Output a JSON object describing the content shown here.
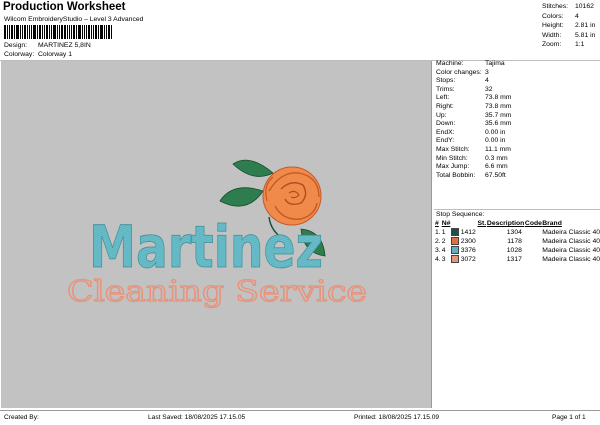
{
  "header": {
    "title": "Production Worksheet",
    "subtitle": "Wilcom EmbroideryStudio – Level 3 Advanced",
    "design_label": "Design:",
    "design_value": "MARTINEZ 5,8IN",
    "colorway_label": "Colorway:",
    "colorway_value": "Colorway 1"
  },
  "stats": [
    {
      "label": "Stitches:",
      "value": "10162"
    },
    {
      "label": "Colors:",
      "value": "4"
    },
    {
      "label": "Height:",
      "value": "2.81 in"
    },
    {
      "label": "Width:",
      "value": "5.81 in"
    },
    {
      "label": "Zoom:",
      "value": "1:1"
    }
  ],
  "design": {
    "word1": "Martinez",
    "word2": "Cleaning Service"
  },
  "machine_info": [
    {
      "label": "Machine:",
      "value": "Tajima"
    },
    {
      "label": "Color changes:",
      "value": "3"
    },
    {
      "label": "Stops:",
      "value": "4"
    },
    {
      "label": "Trims:",
      "value": "32"
    },
    {
      "label": "Left:",
      "value": "73.8 mm"
    },
    {
      "label": "Right:",
      "value": "73.8 mm"
    },
    {
      "label": "Up:",
      "value": "35.7 mm"
    },
    {
      "label": "Down:",
      "value": "35.6 mm"
    },
    {
      "label": "EndX:",
      "value": "0.00 in"
    },
    {
      "label": "EndY:",
      "value": "0.00 in"
    },
    {
      "label": "Max Stitch:",
      "value": "11.1 mm"
    },
    {
      "label": "Min Stitch:",
      "value": "0.3 mm"
    },
    {
      "label": "Max Jump:",
      "value": "6.6 mm"
    },
    {
      "label": "Total Bobbin:",
      "value": "67.50ft"
    }
  ],
  "stop_sequence": {
    "title": "Stop Sequence:",
    "headers": [
      "#",
      "N#",
      "St.",
      "Description",
      "Code",
      "Brand"
    ],
    "rows": [
      {
        "idx": "1.",
        "n": "1",
        "color": "#1e4f49",
        "code_num": "1412",
        "st": "1304",
        "brand": "Madeira Classic 40"
      },
      {
        "idx": "2.",
        "n": "2",
        "color": "#e0713f",
        "code_num": "2300",
        "st": "1178",
        "brand": "Madeira Classic 40"
      },
      {
        "idx": "3.",
        "n": "4",
        "color": "#5eb1bf",
        "code_num": "3376",
        "st": "1028",
        "brand": "Madeira Classic 40"
      },
      {
        "idx": "4.",
        "n": "3",
        "color": "#e8937a",
        "code_num": "3072",
        "st": "1317",
        "brand": "Madeira Classic 40"
      }
    ]
  },
  "footer": {
    "created": "Created By:",
    "saved": "Last Saved: 18/08/2025 17.15.05",
    "printed": "Printed: 18/08/2025 17.15.09",
    "page": "Page 1 of 1"
  },
  "colors": {
    "teal": "#5eb1bf",
    "salmon": "#e8937a",
    "rose": "#f08a4b",
    "leaf": "#2e7d4f"
  }
}
